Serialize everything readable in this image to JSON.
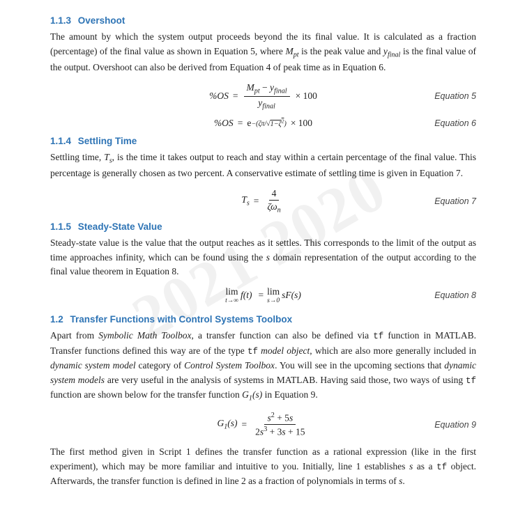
{
  "watermark": {
    "text": "2021 2020"
  },
  "sections": [
    {
      "id": "1.1.3",
      "title": "Overshoot",
      "body": [
        {
          "type": "paragraph",
          "text": "The amount by which the system output proceeds beyond the its final value. It is calculated as a fraction (percentage) of the final value as shown in Equation 5, where M_pt is the peak value and y_final is the final value of the output. Overshoot can also be derived from Equation 4 of peak time as in Equation 6."
        },
        {
          "type": "equation",
          "label": "Equation 5",
          "id": "eq5"
        },
        {
          "type": "equation",
          "label": "Equation 6",
          "id": "eq6"
        }
      ]
    },
    {
      "id": "1.1.4",
      "title": "Settling Time",
      "body": [
        {
          "type": "paragraph",
          "text": "Settling time, T_s, is the time it takes output to reach and stay within a certain percentage of the final value. This percentage is generally chosen as two percent. A conservative estimate of settling time is given in Equation 7."
        },
        {
          "type": "equation",
          "label": "Equation 7",
          "id": "eq7"
        }
      ]
    },
    {
      "id": "1.1.5",
      "title": "Steady-State Value",
      "body": [
        {
          "type": "paragraph",
          "text": "Steady-state value is the value that the output reaches as it settles. This corresponds to the limit of the output as time approaches infinity, which can be found using the s domain representation of the output according to the final value theorem in Equation 8."
        },
        {
          "type": "equation",
          "label": "Equation 8",
          "id": "eq8"
        }
      ]
    }
  ],
  "section_12": {
    "id": "1.2",
    "title": "Transfer Functions with Control Systems Toolbox",
    "paragraphs": [
      "Apart from Symbolic Math Toolbox, a transfer function can also be defined via tf function in MATLAB. Transfer functions defined this way are of the type tf model object, which are also more generally included in dynamic system model category of Control System Toolbox. You will see in the upcoming sections that dynamic system models are very useful in the analysis of systems in MATLAB. Having said those, two ways of using tf function are shown below for the transfer function G₁(s) in Equation 9."
    ],
    "equation_label": "Equation 9",
    "closing_paragraph": "The first method given in Script 1 defines the transfer function as a rational expression (like in the first experiment), which may be more familiar and intuitive to you. Initially, line 1 establishes s as a tf object. Afterwards, the transfer function is defined in line 2 as a fraction of polynomials in terms of s."
  },
  "labels": {
    "eq5": "Equation 5",
    "eq6": "Equation 6",
    "eq7": "Equation 7",
    "eq8": "Equation 8",
    "eq9": "Equation 9"
  }
}
